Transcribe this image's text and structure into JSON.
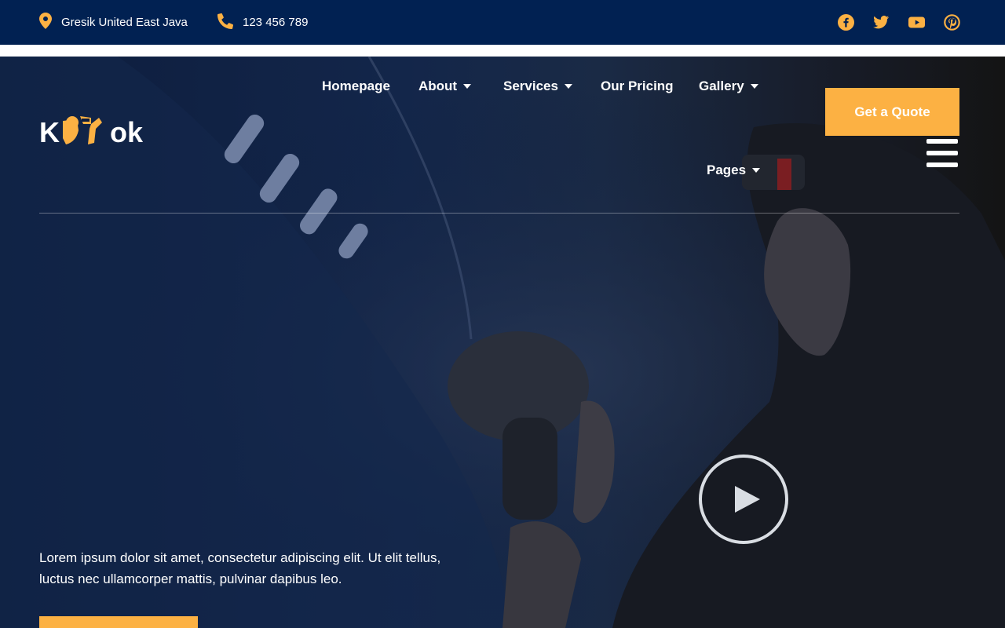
{
  "topbar": {
    "address": "Gresik United East Java",
    "phone": "123 456 789",
    "icons": {
      "address": "map-pin-icon",
      "phone": "phone-icon",
      "social": [
        "facebook-icon",
        "twitter-icon",
        "youtube-icon",
        "pinterest-icon"
      ]
    }
  },
  "logo": {
    "text_start": "K",
    "text_end": "ok",
    "icon": "mechanic-wrench-icon"
  },
  "nav": {
    "items": [
      {
        "label": "Homepage",
        "dropdown": false
      },
      {
        "label": "About",
        "dropdown": true
      },
      {
        "label": "Services",
        "dropdown": true
      },
      {
        "label": "Our Pricing",
        "dropdown": false
      },
      {
        "label": "Gallery",
        "dropdown": true
      },
      {
        "label": "Pages",
        "dropdown": true
      }
    ]
  },
  "cta": {
    "quote_label": "Get a Quote"
  },
  "hero": {
    "description": "Lorem ipsum dolor sit amet, consectetur adipiscing elit. Ut elit tellus, luctus nec ullamcorper mattis, pulvinar dapibus leo.",
    "play_icon": "play-icon",
    "menu_icon": "hamburger-menu-icon"
  },
  "colors": {
    "navy": "#012152",
    "accent": "#fcb143",
    "white": "#ffffff"
  }
}
